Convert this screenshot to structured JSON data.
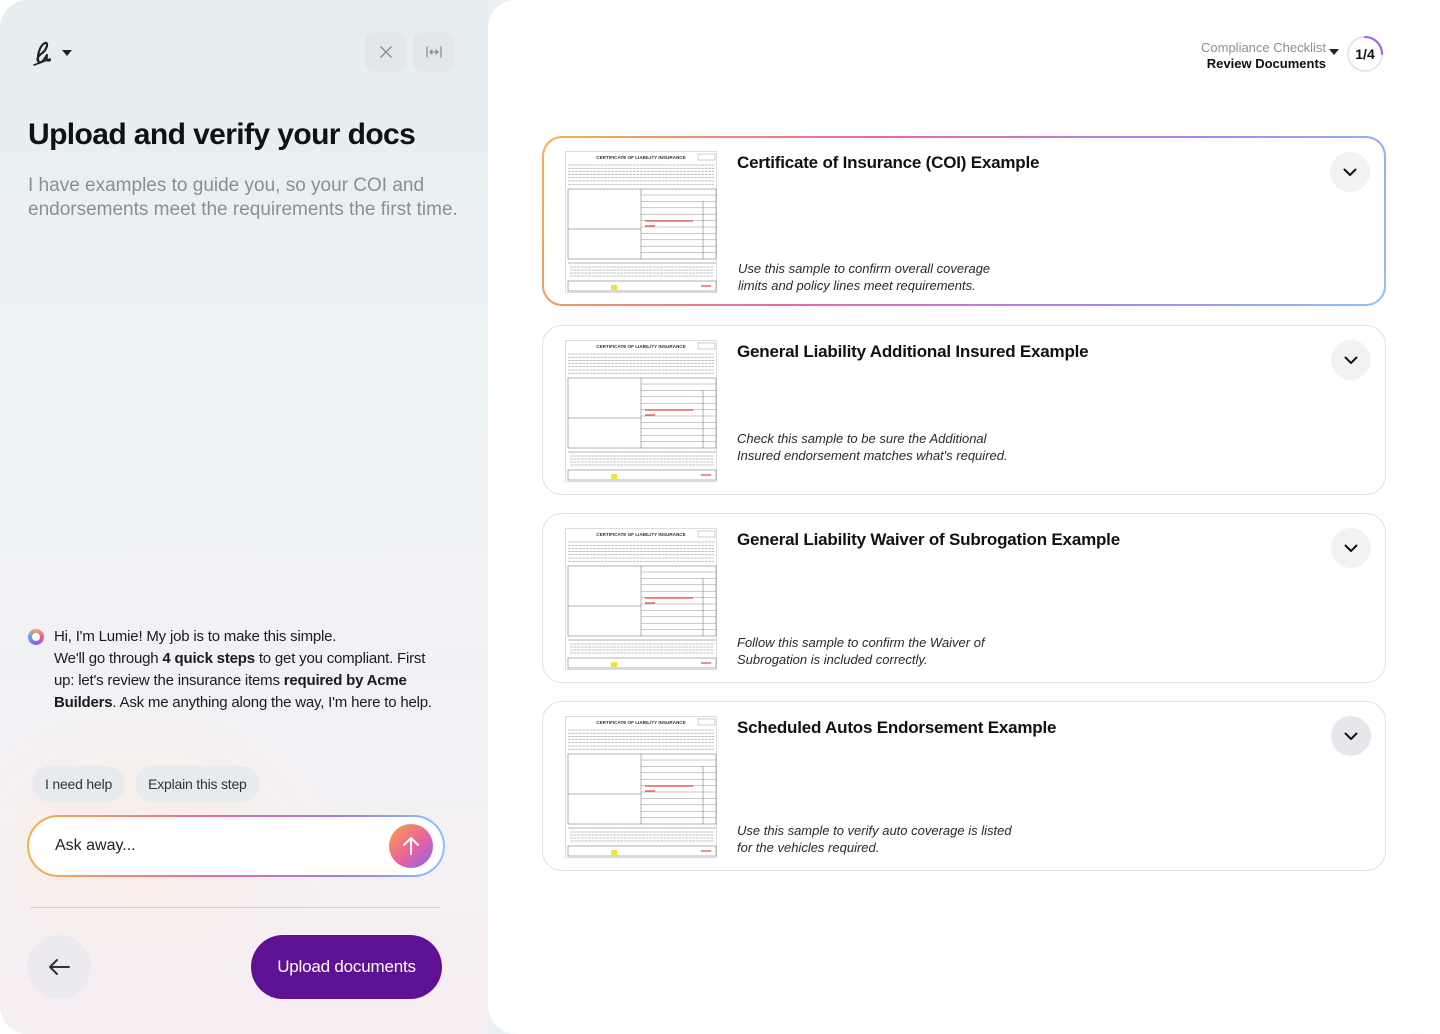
{
  "header": {
    "close_icon": "close-icon",
    "expand_icon": "expand-horizontal-icon"
  },
  "intro": {
    "title": "Upload and verify your docs",
    "subtitle": "I have examples to guide you, so your COI and endorsements meet the requirements the first time."
  },
  "assistant": {
    "greeting": "Hi, I'm Lumie! My job is to make this simple.",
    "line2_pre": "We'll go through ",
    "line2_bold": "4 quick steps",
    "line2_post": " to get you compliant. First up: let's review the insurance items ",
    "line2_bold2": "required by Acme Builders",
    "line2_end": ". Ask me anything along the way, I'm here to help."
  },
  "chips": [
    "I need help",
    "Explain this step"
  ],
  "ask": {
    "placeholder": "Ask away..."
  },
  "footer": {
    "upload_label": "Upload documents"
  },
  "checklist": {
    "label": "Compliance Checklist",
    "step": "Review Documents",
    "progress_text": "1/4",
    "progress_fraction": 0.25
  },
  "colors": {
    "primary": "#5e1293",
    "muted": "#8a8f95"
  },
  "cards": [
    {
      "title": "Certificate of Insurance (COI) Example",
      "description": "Use this sample to confirm overall coverage limits and policy lines meet requirements.",
      "thumb_heading": "CERTIFICATE OF LIABILITY INSURANCE",
      "active": true
    },
    {
      "title": "General Liability Additional Insured Example",
      "description": "Check this sample to be sure the Additional Insured endorsement matches what's required.",
      "thumb_heading": "CERTIFICATE OF LIABILITY INSURANCE",
      "active": false
    },
    {
      "title": "General Liability Waiver of Subrogation Example",
      "description": "Follow this sample to confirm the Waiver of Subrogation is included correctly.",
      "thumb_heading": "CERTIFICATE OF LIABILITY INSURANCE",
      "active": false
    },
    {
      "title": "Scheduled Autos Endorsement Example",
      "description": "Use this sample to verify auto coverage is listed for the vehicles required.",
      "thumb_heading": "CERTIFICATE OF LIABILITY INSURANCE",
      "active": false
    }
  ]
}
